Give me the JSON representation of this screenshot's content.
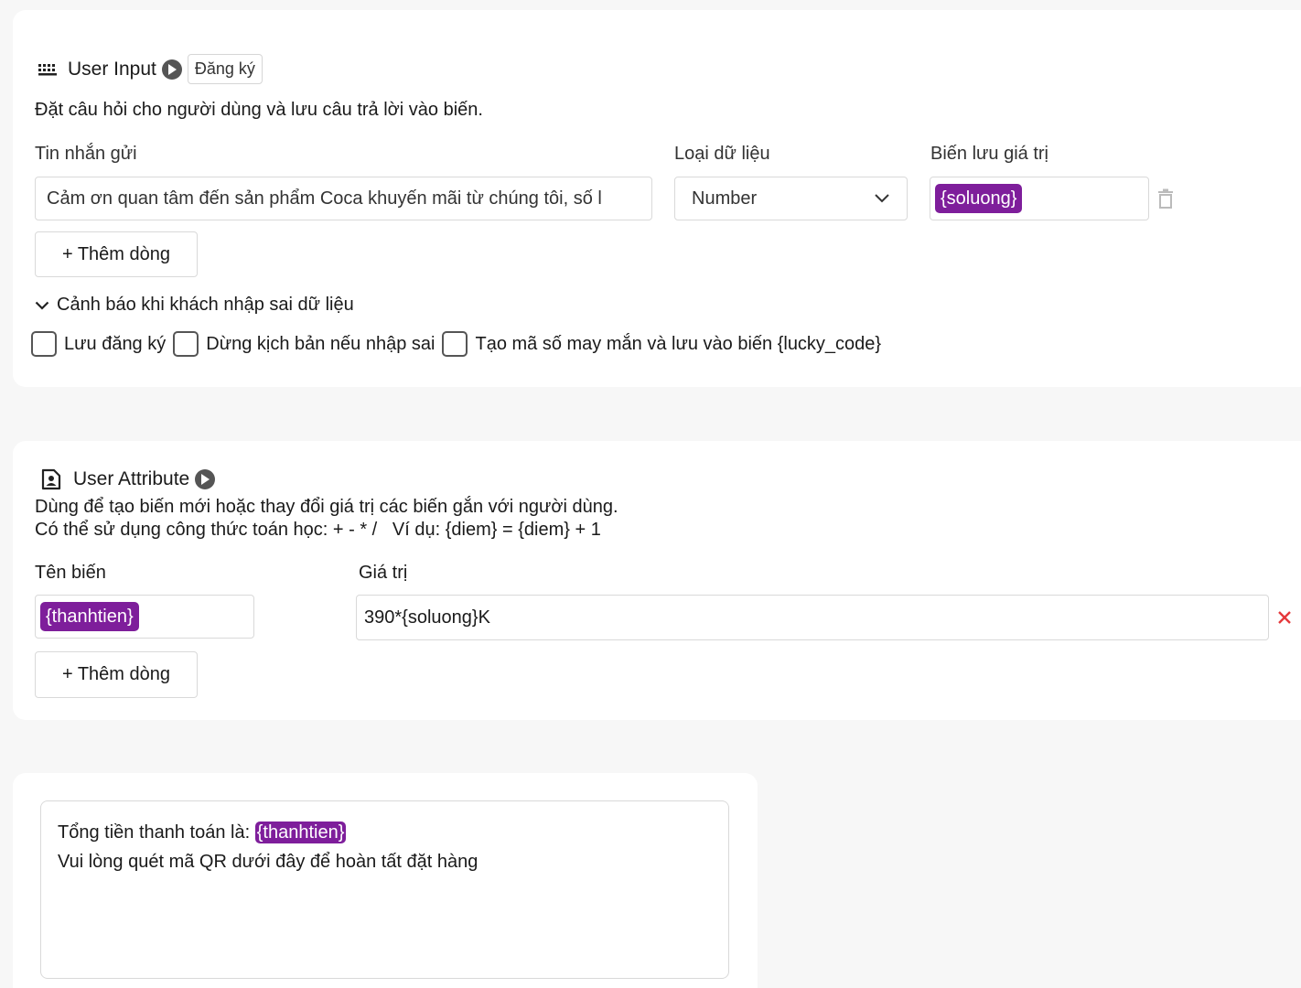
{
  "user_input": {
    "title": "User Input",
    "tag": "Đăng ký",
    "description": "Đặt câu hỏi cho người dùng và lưu câu trả lời vào biến.",
    "message_label": "Tin nhắn gửi",
    "message_value": "Cảm ơn quan tâm đến sản phẩm Coca khuyến mãi từ chúng tôi, số l",
    "datatype_label": "Loại dữ liệu",
    "datatype_value": "Number",
    "variable_label": "Biến lưu giá trị",
    "variable_chip": "{soluong}",
    "add_row_label": "+ Thêm dòng",
    "warning_toggle_label": "Cảnh báo khi khách nhập sai dữ liệu",
    "checkboxes": [
      {
        "label": "Lưu đăng ký",
        "checked": false
      },
      {
        "label": "Dừng kịch bản nếu nhập sai",
        "checked": false
      },
      {
        "label": "Tạo mã số may mắn và lưu vào biến {lucky_code}",
        "checked": false
      }
    ]
  },
  "user_attribute": {
    "title": "User Attribute",
    "description_line1": "Dùng để tạo biến mới hoặc thay đổi giá trị các biến gắn với người dùng.",
    "description_line2": "Có thể sử dụng công thức toán học: + - * /   Ví dụ: {diem} = {diem} + 1",
    "name_label": "Tên biến",
    "value_label": "Giá trị",
    "name_chip": "{thanhtien}",
    "value_text": "390*{soluong}K",
    "add_row_label": "+ Thêm dòng"
  },
  "text_message": {
    "line1_prefix": "Tổng tiền thanh toán là: ",
    "line1_chip": "{thanhtien}",
    "line2": "Vui lòng quét mã QR dưới đây để hoàn tất đặt hàng"
  },
  "colors": {
    "chip": "#7e1e9b",
    "delete_x": "#e5383b",
    "page_bg": "#f7f7f7"
  }
}
